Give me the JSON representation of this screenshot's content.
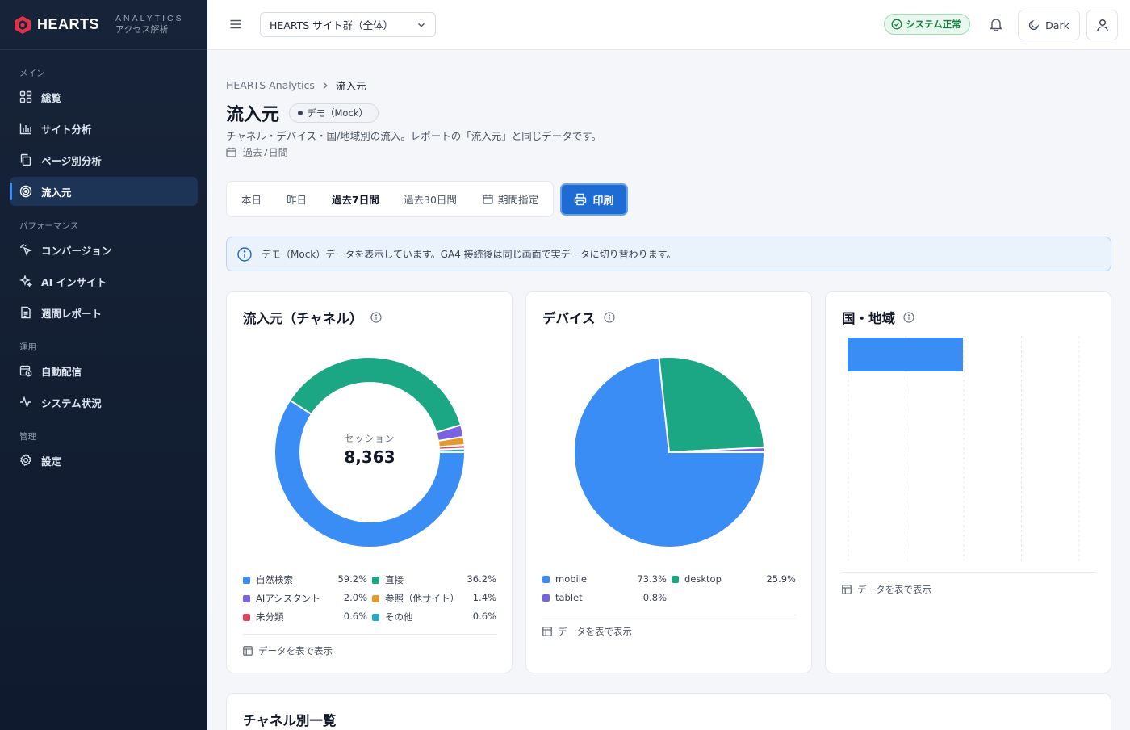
{
  "brand": {
    "name": "HEARTS",
    "sub1": "ANALYTICS",
    "sub2": "アクセス解析"
  },
  "sidebar": {
    "sections": [
      {
        "label": "メイン",
        "items": [
          {
            "label": "総覧",
            "icon": "grid-icon"
          },
          {
            "label": "サイト分析",
            "icon": "bar-chart-icon"
          },
          {
            "label": "ページ別分析",
            "icon": "copy-icon"
          },
          {
            "label": "流入元",
            "icon": "target-icon",
            "active": true
          }
        ]
      },
      {
        "label": "パフォーマンス",
        "items": [
          {
            "label": "コンバージョン",
            "icon": "cursor-click-icon"
          },
          {
            "label": "AI インサイト",
            "icon": "sparkles-icon"
          },
          {
            "label": "週間レポート",
            "icon": "document-icon"
          }
        ]
      },
      {
        "label": "運用",
        "items": [
          {
            "label": "自動配信",
            "icon": "calendar-clock-icon"
          },
          {
            "label": "システム状況",
            "icon": "activity-icon"
          }
        ]
      },
      {
        "label": "管理",
        "items": [
          {
            "label": "設定",
            "icon": "gear-icon"
          }
        ]
      }
    ]
  },
  "topbar": {
    "site_select": "HEARTS サイト群（全体）",
    "status": "システム正常",
    "theme_label": "Dark"
  },
  "breadcrumb": {
    "root": "HEARTS Analytics",
    "current": "流入元"
  },
  "page": {
    "title": "流入元",
    "badge": "デモ（Mock）",
    "description": "チャネル・デバイス・国/地域別の流入。レポートの「流入元」と同じデータです。",
    "period": "過去7日間"
  },
  "tabs": [
    "本日",
    "昨日",
    "過去7日間",
    "過去30日間",
    "期間指定"
  ],
  "active_tab": "過去7日間",
  "print_label": "印刷",
  "banner": "デモ（Mock）データを表示しています。GA4 接続後は同じ画面で実データに切り替わります。",
  "cards": {
    "channel": {
      "title": "流入元（チャネル）",
      "center_label": "セッション",
      "center_value": "8,363",
      "table_link": "データを表で表示"
    },
    "device": {
      "title": "デバイス",
      "table_link": "データを表で表示"
    },
    "country": {
      "title": "国・地域",
      "table_link": "データを表で表示"
    }
  },
  "bottom_title": "チャネル別一覧",
  "chart_data": [
    {
      "type": "pie",
      "title": "流入元（チャネル）",
      "categories": [
        "自然検索",
        "直接",
        "AIアシスタント",
        "参照（他サイト）",
        "未分類",
        "その他"
      ],
      "values": [
        59.2,
        36.2,
        2.0,
        1.4,
        0.6,
        0.6
      ],
      "labels": [
        "59.2%",
        "36.2%",
        "2.0%",
        "1.4%",
        "0.6%",
        "0.6%"
      ],
      "colors": [
        "#3a8df5",
        "#1ba784",
        "#7a63e0",
        "#e39a2d",
        "#d9485f",
        "#2aa9c3"
      ]
    },
    {
      "type": "pie",
      "title": "デバイス",
      "categories": [
        "mobile",
        "desktop",
        "tablet"
      ],
      "values": [
        73.3,
        25.9,
        0.8
      ],
      "labels": [
        "73.3%",
        "25.9%",
        "0.8%"
      ],
      "colors": [
        "#3a8df5",
        "#1ba784",
        "#7a63e0"
      ]
    },
    {
      "type": "bar",
      "title": "国・地域",
      "values": [
        1
      ],
      "xlim": [
        0,
        2
      ],
      "colors": [
        "#3a8df5"
      ]
    }
  ]
}
